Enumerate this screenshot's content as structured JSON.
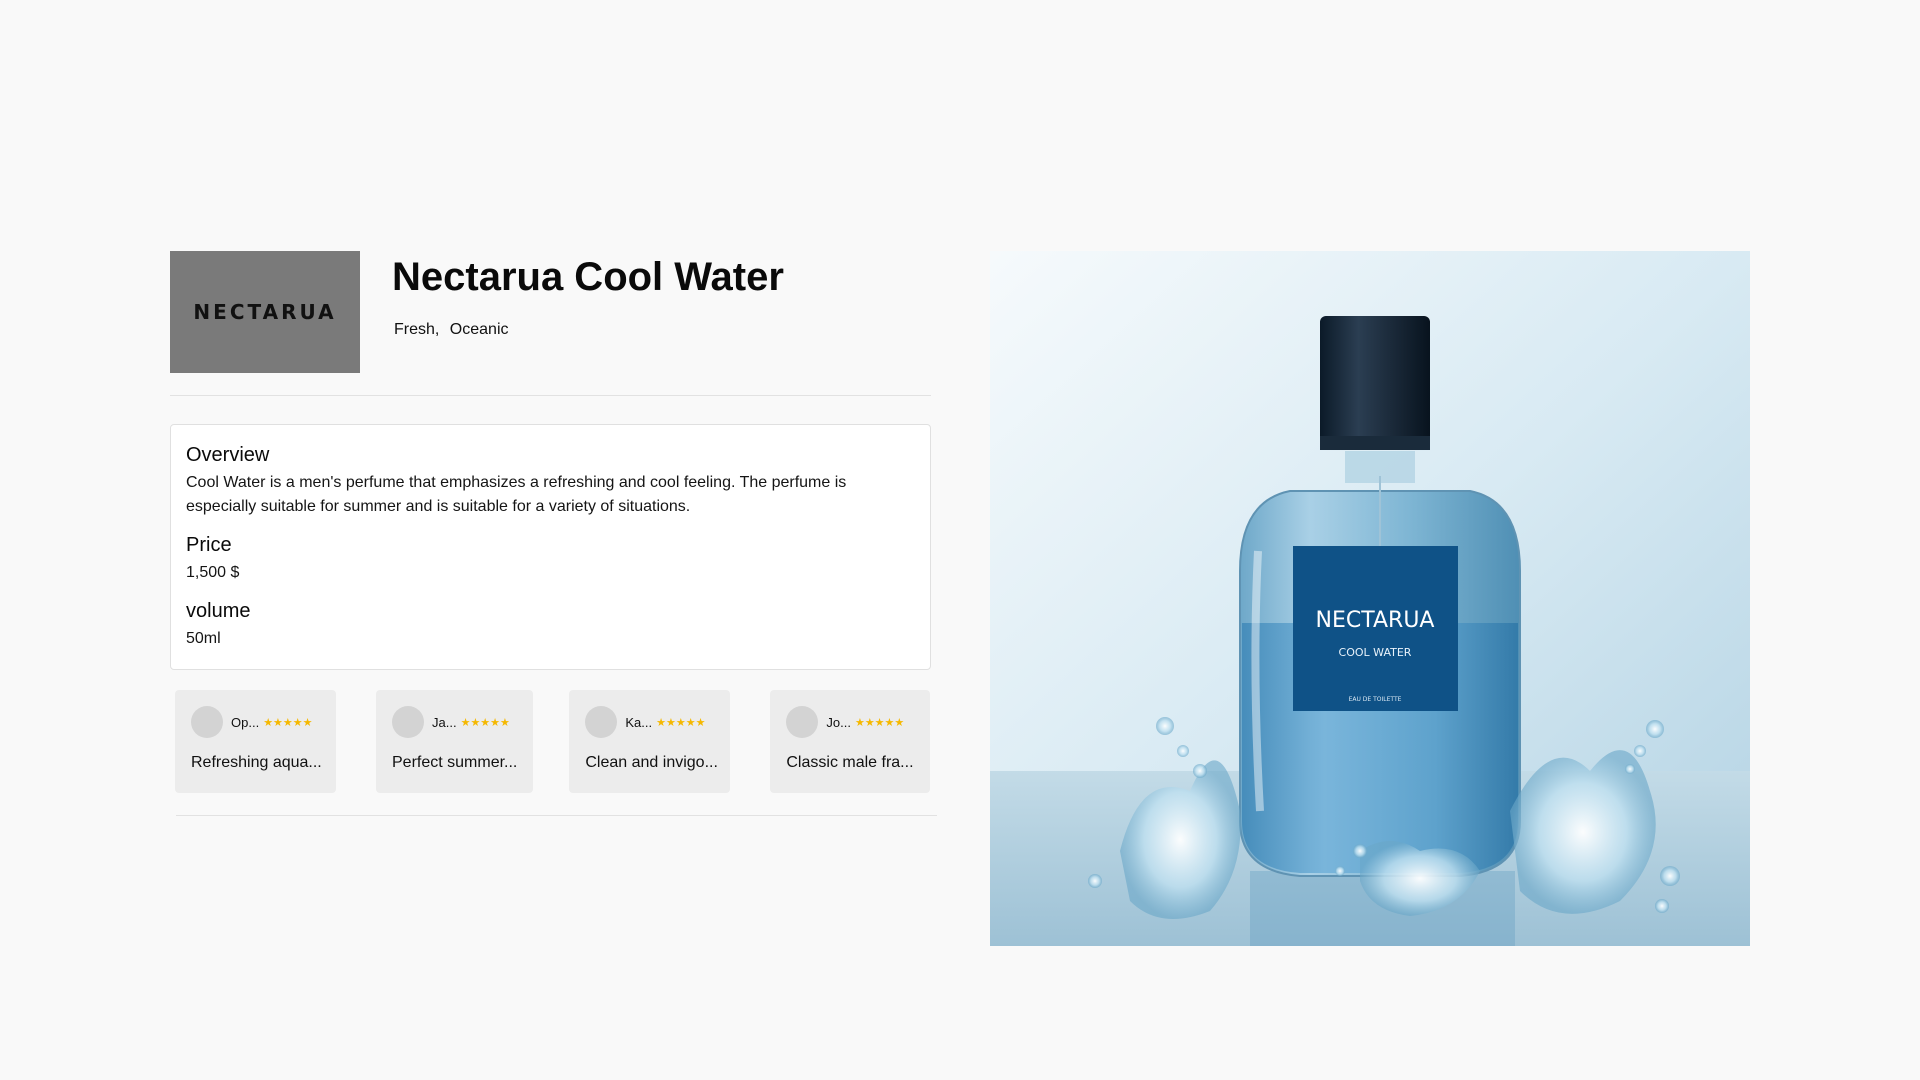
{
  "brand": {
    "logo_text": "NECTARUA"
  },
  "product": {
    "title": "Nectarua Cool Water",
    "tags": [
      "Fresh,",
      "Oceanic"
    ]
  },
  "details": {
    "overview_title": "Overview",
    "overview_text": "Cool Water is a men's perfume that emphasizes a refreshing and cool feeling. The perfume is especially suitable for summer and is suitable for a variety of situations.",
    "price_title": "Price",
    "price_value": "1,500 $",
    "volume_title": "volume",
    "volume_value": "50ml"
  },
  "reviews": [
    {
      "name": "Op...",
      "rating": 5,
      "stars": "★★★★★",
      "text": "Refreshing aqua..."
    },
    {
      "name": "Ja...",
      "rating": 5,
      "stars": "★★★★★",
      "text": "Perfect summer..."
    },
    {
      "name": "Ka...",
      "rating": 5,
      "stars": "★★★★★",
      "text": "Clean and invigo..."
    },
    {
      "name": "Jo...",
      "rating": 5,
      "stars": "★★★★★",
      "text": "Classic male fra..."
    }
  ],
  "hero_image": {
    "label_brand": "NECTARUA",
    "label_name": "COOL WATER",
    "label_sub": "EAU DE TOILETTE"
  },
  "colors": {
    "star": "#f5b800",
    "logo_bg": "#7a7a7a",
    "bottle_label": "#0f5287"
  }
}
